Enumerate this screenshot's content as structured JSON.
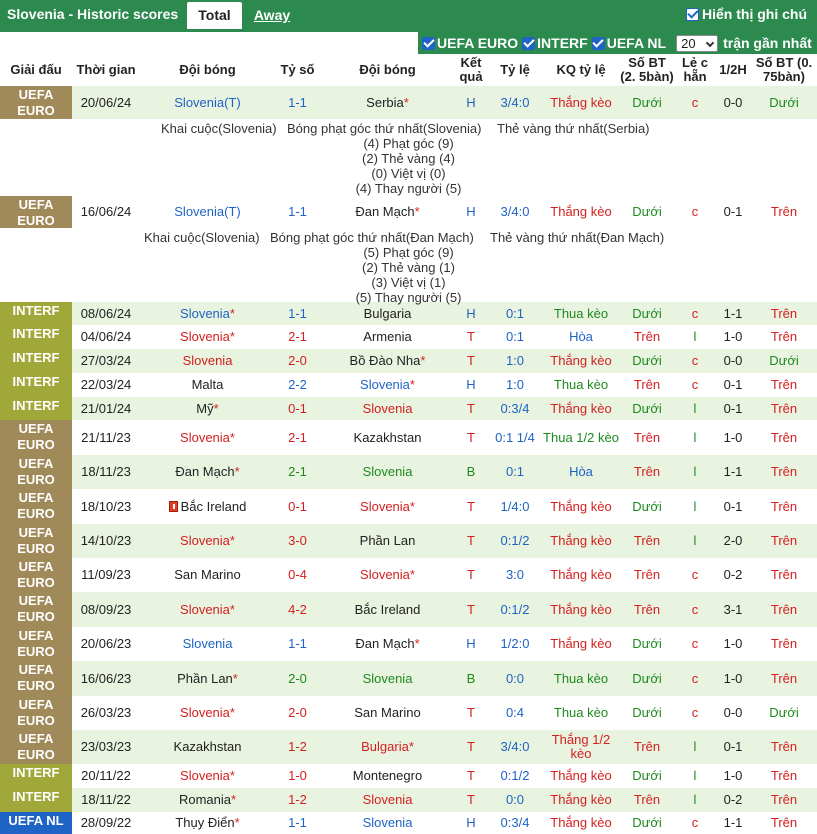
{
  "topbar": {
    "title": "Slovenia - Historic scores",
    "tab_total": "Total",
    "tab_away": "Away",
    "show_all_label": "Hiển thị ghi chú"
  },
  "filters": {
    "items": [
      "UEFA EURO",
      "INTERF",
      "UEFA NL"
    ],
    "count_value": "20",
    "recent_label": "trận gần nhất"
  },
  "headers": {
    "league": "Giải đấu",
    "time": "Thời gian",
    "home": "Đội bóng",
    "score": "Tỷ số",
    "away": "Đội bóng",
    "result": "Kết quả",
    "odds": "Tỷ lệ",
    "odds_result": "KQ tỷ lệ",
    "goals_25": "Số BT (2. 5bàn)",
    "odd_even": "Lẻ c hẵn",
    "half": "1/2H",
    "goals_075": "Số BT (0. 75bàn)"
  },
  "details": [
    {
      "kickoff": "Khai cuộc(Slovenia)",
      "first_corner": "Bóng phạt góc thứ nhất(Slovenia)",
      "first_yellow": "Thẻ vàng thứ nhất(Serbia)",
      "corners": "(4) Phạt góc (9)",
      "yellows": "(2) Thẻ vàng (4)",
      "offsides": "(0) Việt vị (0)",
      "subs": "(4) Thay người (5)"
    },
    {
      "kickoff": "Khai cuộc(Slovenia)",
      "first_corner": "Bóng phạt góc thứ nhất(Đan Mạch)",
      "first_yellow": "Thẻ vàng thứ nhất(Đan Mạch)",
      "corners": "(5) Phạt góc (9)",
      "yellows": "(2) Thẻ vàng (1)",
      "offsides": "(3) Việt vị (1)",
      "subs": "(5) Thay người (5)"
    }
  ],
  "colors": {
    "header_green": "#2c8a4e",
    "euro": "#a08a5a",
    "interf": "#a0a83a",
    "nl": "#1f63c6",
    "row_alt": "#e8f3e0",
    "win": "#d42020",
    "draw": "#1e8a1e",
    "team_blue": "#1f63c6"
  },
  "matches": [
    {
      "league": "UEFA EURO",
      "date": "20/06/24",
      "home": "Slovenia(T)",
      "home_star": false,
      "score": "1-1",
      "away": "Serbia",
      "away_star": true,
      "result": "H",
      "odds": "3/4:0",
      "odds_result": "Thắng kèo",
      "goals25": "Dưới",
      "oe": "c",
      "half": "0-0",
      "goals075": "Dưới"
    },
    {
      "league": "UEFA EURO",
      "date": "16/06/24",
      "home": "Slovenia(T)",
      "home_star": false,
      "score": "1-1",
      "away": "Đan Mạch",
      "away_star": true,
      "result": "H",
      "odds": "3/4:0",
      "odds_result": "Thắng kèo",
      "goals25": "Dưới",
      "oe": "c",
      "half": "0-1",
      "goals075": "Trên"
    },
    {
      "league": "INTERF",
      "date": "08/06/24",
      "home": "Slovenia",
      "home_star": true,
      "score": "1-1",
      "away": "Bulgaria",
      "away_star": false,
      "result": "H",
      "odds": "0:1",
      "odds_result": "Thua kèo",
      "goals25": "Dưới",
      "oe": "c",
      "half": "1-1",
      "goals075": "Trên"
    },
    {
      "league": "INTERF",
      "date": "04/06/24",
      "home": "Slovenia",
      "home_star": true,
      "score": "2-1",
      "away": "Armenia",
      "away_star": false,
      "result": "T",
      "odds": "0:1",
      "odds_result": "Hòa",
      "goals25": "Trên",
      "oe": "l",
      "half": "1-0",
      "goals075": "Trên"
    },
    {
      "league": "INTERF",
      "date": "27/03/24",
      "home": "Slovenia",
      "home_star": false,
      "score": "2-0",
      "away": "Bồ Đào Nha",
      "away_star": true,
      "result": "T",
      "odds": "1:0",
      "odds_result": "Thắng kèo",
      "goals25": "Dưới",
      "oe": "c",
      "half": "0-0",
      "goals075": "Dưới"
    },
    {
      "league": "INTERF",
      "date": "22/03/24",
      "home": "Malta",
      "home_star": false,
      "score": "2-2",
      "away": "Slovenia",
      "away_star": true,
      "result": "H",
      "odds": "1:0",
      "odds_result": "Thua kèo",
      "goals25": "Trên",
      "oe": "c",
      "half": "0-1",
      "goals075": "Trên"
    },
    {
      "league": "INTERF",
      "date": "21/01/24",
      "home": "Mỹ",
      "home_star": true,
      "score": "0-1",
      "away": "Slovenia",
      "away_star": false,
      "result": "T",
      "odds": "0:3/4",
      "odds_result": "Thắng kèo",
      "goals25": "Dưới",
      "oe": "l",
      "half": "0-1",
      "goals075": "Trên"
    },
    {
      "league": "UEFA EURO",
      "date": "21/11/23",
      "home": "Slovenia",
      "home_star": true,
      "score": "2-1",
      "away": "Kazakhstan",
      "away_star": false,
      "result": "T",
      "odds": "0:1 1/4",
      "odds_result": "Thua 1/2 kèo",
      "goals25": "Trên",
      "oe": "l",
      "half": "1-0",
      "goals075": "Trên"
    },
    {
      "league": "UEFA EURO",
      "date": "18/11/23",
      "home": "Đan Mạch",
      "home_star": true,
      "score": "2-1",
      "away": "Slovenia",
      "away_star": false,
      "result": "B",
      "odds": "0:1",
      "odds_result": "Hòa",
      "goals25": "Trên",
      "oe": "l",
      "half": "1-1",
      "goals075": "Trên"
    },
    {
      "league": "UEFA EURO",
      "date": "18/10/23",
      "home": "Bắc Ireland",
      "home_star": false,
      "home_flag": true,
      "score": "0-1",
      "away": "Slovenia",
      "away_star": true,
      "result": "T",
      "odds": "1/4:0",
      "odds_result": "Thắng kèo",
      "goals25": "Dưới",
      "oe": "l",
      "half": "0-1",
      "goals075": "Trên"
    },
    {
      "league": "UEFA EURO",
      "date": "14/10/23",
      "home": "Slovenia",
      "home_star": true,
      "score": "3-0",
      "away": "Phần Lan",
      "away_star": false,
      "result": "T",
      "odds": "0:1/2",
      "odds_result": "Thắng kèo",
      "goals25": "Trên",
      "oe": "l",
      "half": "2-0",
      "goals075": "Trên"
    },
    {
      "league": "UEFA EURO",
      "date": "11/09/23",
      "home": "San Marino",
      "home_star": false,
      "score": "0-4",
      "away": "Slovenia",
      "away_star": true,
      "result": "T",
      "odds": "3:0",
      "odds_result": "Thắng kèo",
      "goals25": "Trên",
      "oe": "c",
      "half": "0-2",
      "goals075": "Trên"
    },
    {
      "league": "UEFA EURO",
      "date": "08/09/23",
      "home": "Slovenia",
      "home_star": true,
      "score": "4-2",
      "away": "Bắc Ireland",
      "away_star": false,
      "result": "T",
      "odds": "0:1/2",
      "odds_result": "Thắng kèo",
      "goals25": "Trên",
      "oe": "c",
      "half": "3-1",
      "goals075": "Trên"
    },
    {
      "league": "UEFA EURO",
      "date": "20/06/23",
      "home": "Slovenia",
      "home_star": false,
      "score": "1-1",
      "away": "Đan Mạch",
      "away_star": true,
      "result": "H",
      "odds": "1/2:0",
      "odds_result": "Thắng kèo",
      "goals25": "Dưới",
      "oe": "c",
      "half": "1-0",
      "goals075": "Trên"
    },
    {
      "league": "UEFA EURO",
      "date": "16/06/23",
      "home": "Phần Lan",
      "home_star": true,
      "score": "2-0",
      "away": "Slovenia",
      "away_star": false,
      "result": "B",
      "odds": "0:0",
      "odds_result": "Thua kèo",
      "goals25": "Dưới",
      "oe": "c",
      "half": "1-0",
      "goals075": "Trên"
    },
    {
      "league": "UEFA EURO",
      "date": "26/03/23",
      "home": "Slovenia",
      "home_star": true,
      "score": "2-0",
      "away": "San Marino",
      "away_star": false,
      "result": "T",
      "odds": "0:4",
      "odds_result": "Thua kèo",
      "goals25": "Dưới",
      "oe": "c",
      "half": "0-0",
      "goals075": "Dưới"
    },
    {
      "league": "UEFA EURO",
      "date": "23/03/23",
      "home": "Kazakhstan",
      "home_star": false,
      "score": "1-2",
      "away": "Bulgaria",
      "away_star": true,
      "result": "T",
      "odds": "3/4:0",
      "odds_result": "Thắng 1/2 kèo",
      "goals25": "Trên",
      "oe": "l",
      "half": "0-1",
      "goals075": "Trên"
    },
    {
      "league": "INTERF",
      "date": "20/11/22",
      "home": "Slovenia",
      "home_star": true,
      "score": "1-0",
      "away": "Montenegro",
      "away_star": false,
      "result": "T",
      "odds": "0:1/2",
      "odds_result": "Thắng kèo",
      "goals25": "Dưới",
      "oe": "l",
      "half": "1-0",
      "goals075": "Trên"
    },
    {
      "league": "INTERF",
      "date": "18/11/22",
      "home": "Romania",
      "home_star": true,
      "score": "1-2",
      "away": "Slovenia",
      "away_star": false,
      "result": "T",
      "odds": "0:0",
      "odds_result": "Thắng kèo",
      "goals25": "Trên",
      "oe": "l",
      "half": "0-2",
      "goals075": "Trên"
    },
    {
      "league": "UEFA NL",
      "date": "28/09/22",
      "home": "Thụy Điển",
      "home_star": true,
      "score": "1-1",
      "away": "Slovenia",
      "away_star": false,
      "result": "H",
      "odds": "0:3/4",
      "odds_result": "Thắng kèo",
      "goals25": "Dưới",
      "oe": "c",
      "half": "1-1",
      "goals075": "Trên"
    }
  ]
}
